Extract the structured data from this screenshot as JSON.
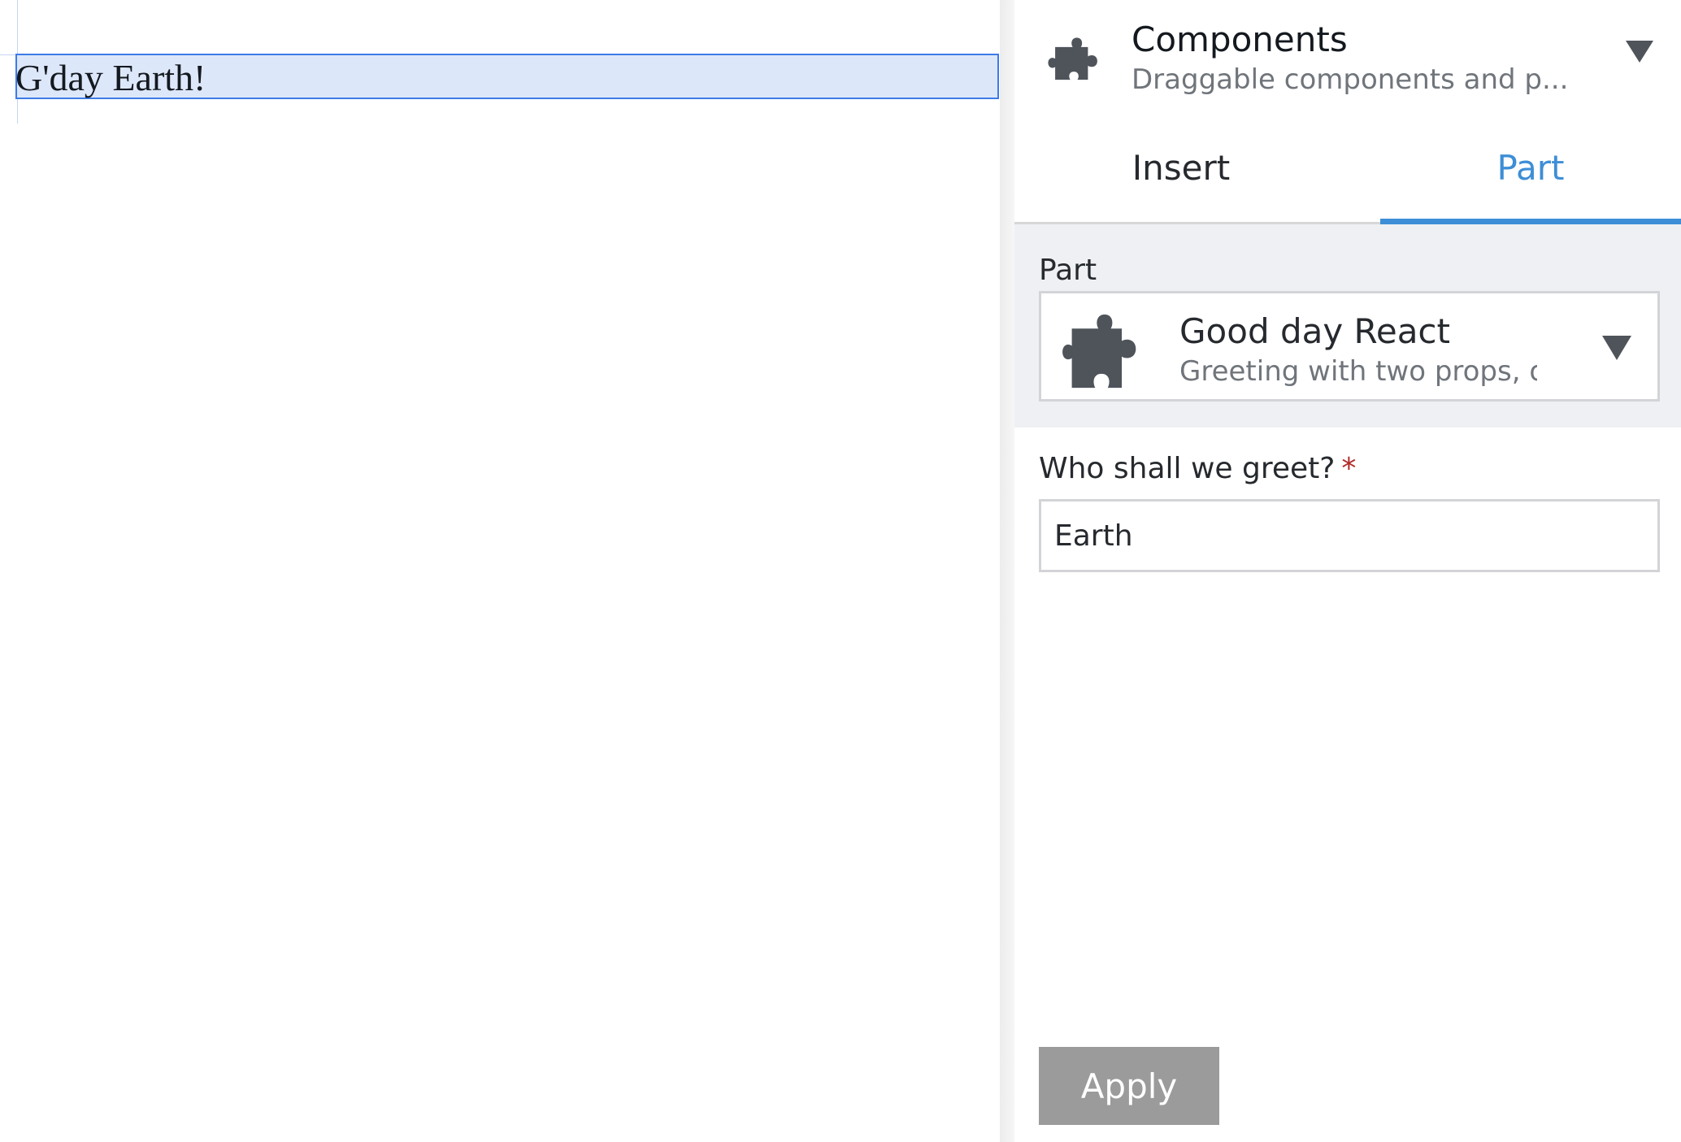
{
  "editor": {
    "selected_text": "G'day Earth!"
  },
  "sidebar": {
    "header": {
      "icon": "puzzle-piece-icon",
      "title": "Components",
      "subtitle": "Draggable components and p..."
    },
    "tabs": [
      {
        "label": "Insert",
        "active": false
      },
      {
        "label": "Part",
        "active": true
      }
    ],
    "part_section": {
      "label": "Part",
      "selected": {
        "icon": "puzzle-piece-icon",
        "title": "Good day React",
        "description": "Greeting with two props, o..."
      }
    },
    "greet_field": {
      "label": "Who shall we greet?",
      "required_marker": "*",
      "value": "Earth"
    },
    "apply_label": "Apply"
  },
  "colors": {
    "accent": "#3d8ed6",
    "selection_fill": "#dde7fa",
    "selection_border": "#3d7be6",
    "icon_gray": "#4f545b",
    "button_gray": "#9b9b9b",
    "required": "#b02a2a"
  }
}
